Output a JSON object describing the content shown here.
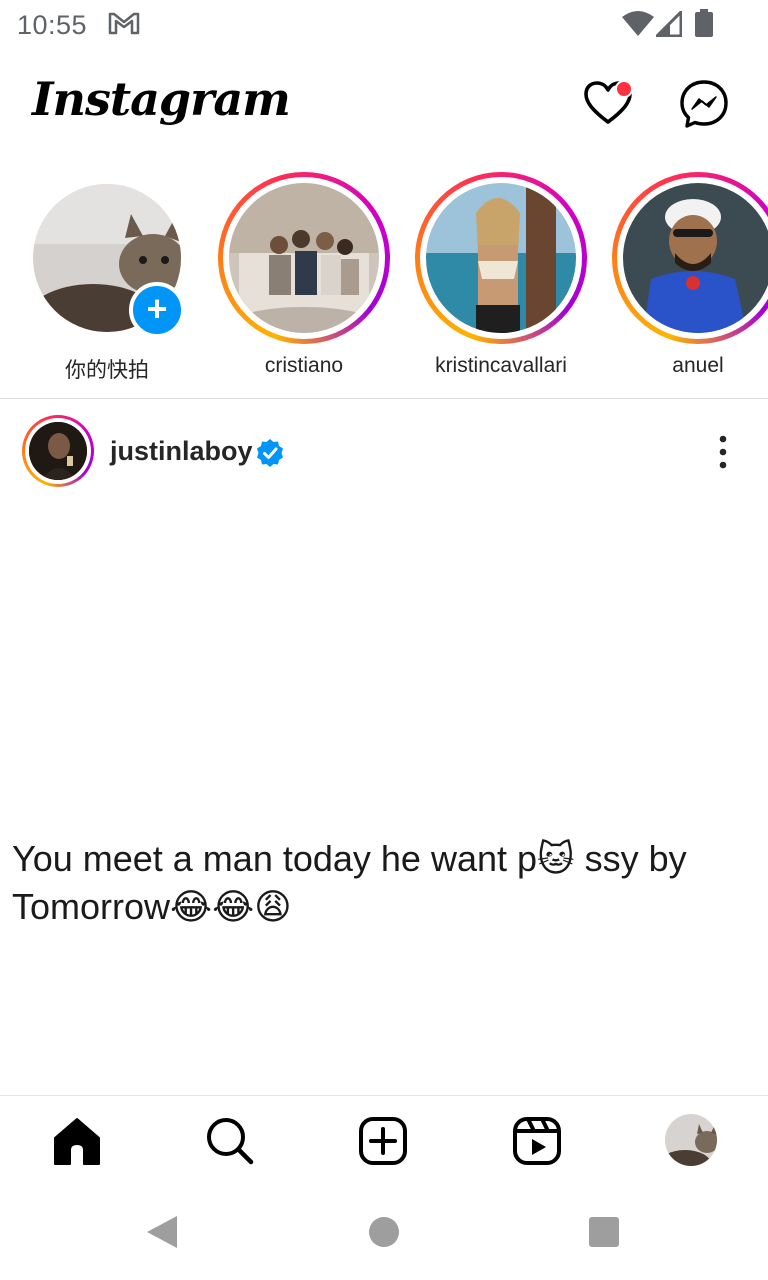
{
  "status_bar": {
    "time": "10:55",
    "icons": [
      "gmail-icon",
      "wifi-icon",
      "signal-icon",
      "battery-icon"
    ]
  },
  "header": {
    "logo": "Instagram",
    "icons": [
      "heart-icon",
      "messenger-icon"
    ],
    "notification_dot_color": "#ff3040"
  },
  "stories": [
    {
      "name": "你的快拍",
      "own": true
    },
    {
      "name": "cristiano"
    },
    {
      "name": "kristincavallari"
    },
    {
      "name": "anuel"
    }
  ],
  "post": {
    "username": "justinlaboy",
    "verified": true,
    "text_line1_a": "You meet a man today he want p",
    "text_line1_emoji": "🐱",
    "text_line1_b": "ssy by",
    "text_line2_a": "Tomorrow",
    "text_line2_emojis": "😂😂😩"
  },
  "bottom_nav": {
    "items": [
      "home-icon",
      "search-icon",
      "create-icon",
      "reels-icon",
      "profile-avatar"
    ]
  },
  "colors": {
    "accent_blue": "#0095f6",
    "story_gradient": [
      "#ffb400",
      "#ff2d55",
      "#d300c5"
    ],
    "text": "#262626"
  }
}
